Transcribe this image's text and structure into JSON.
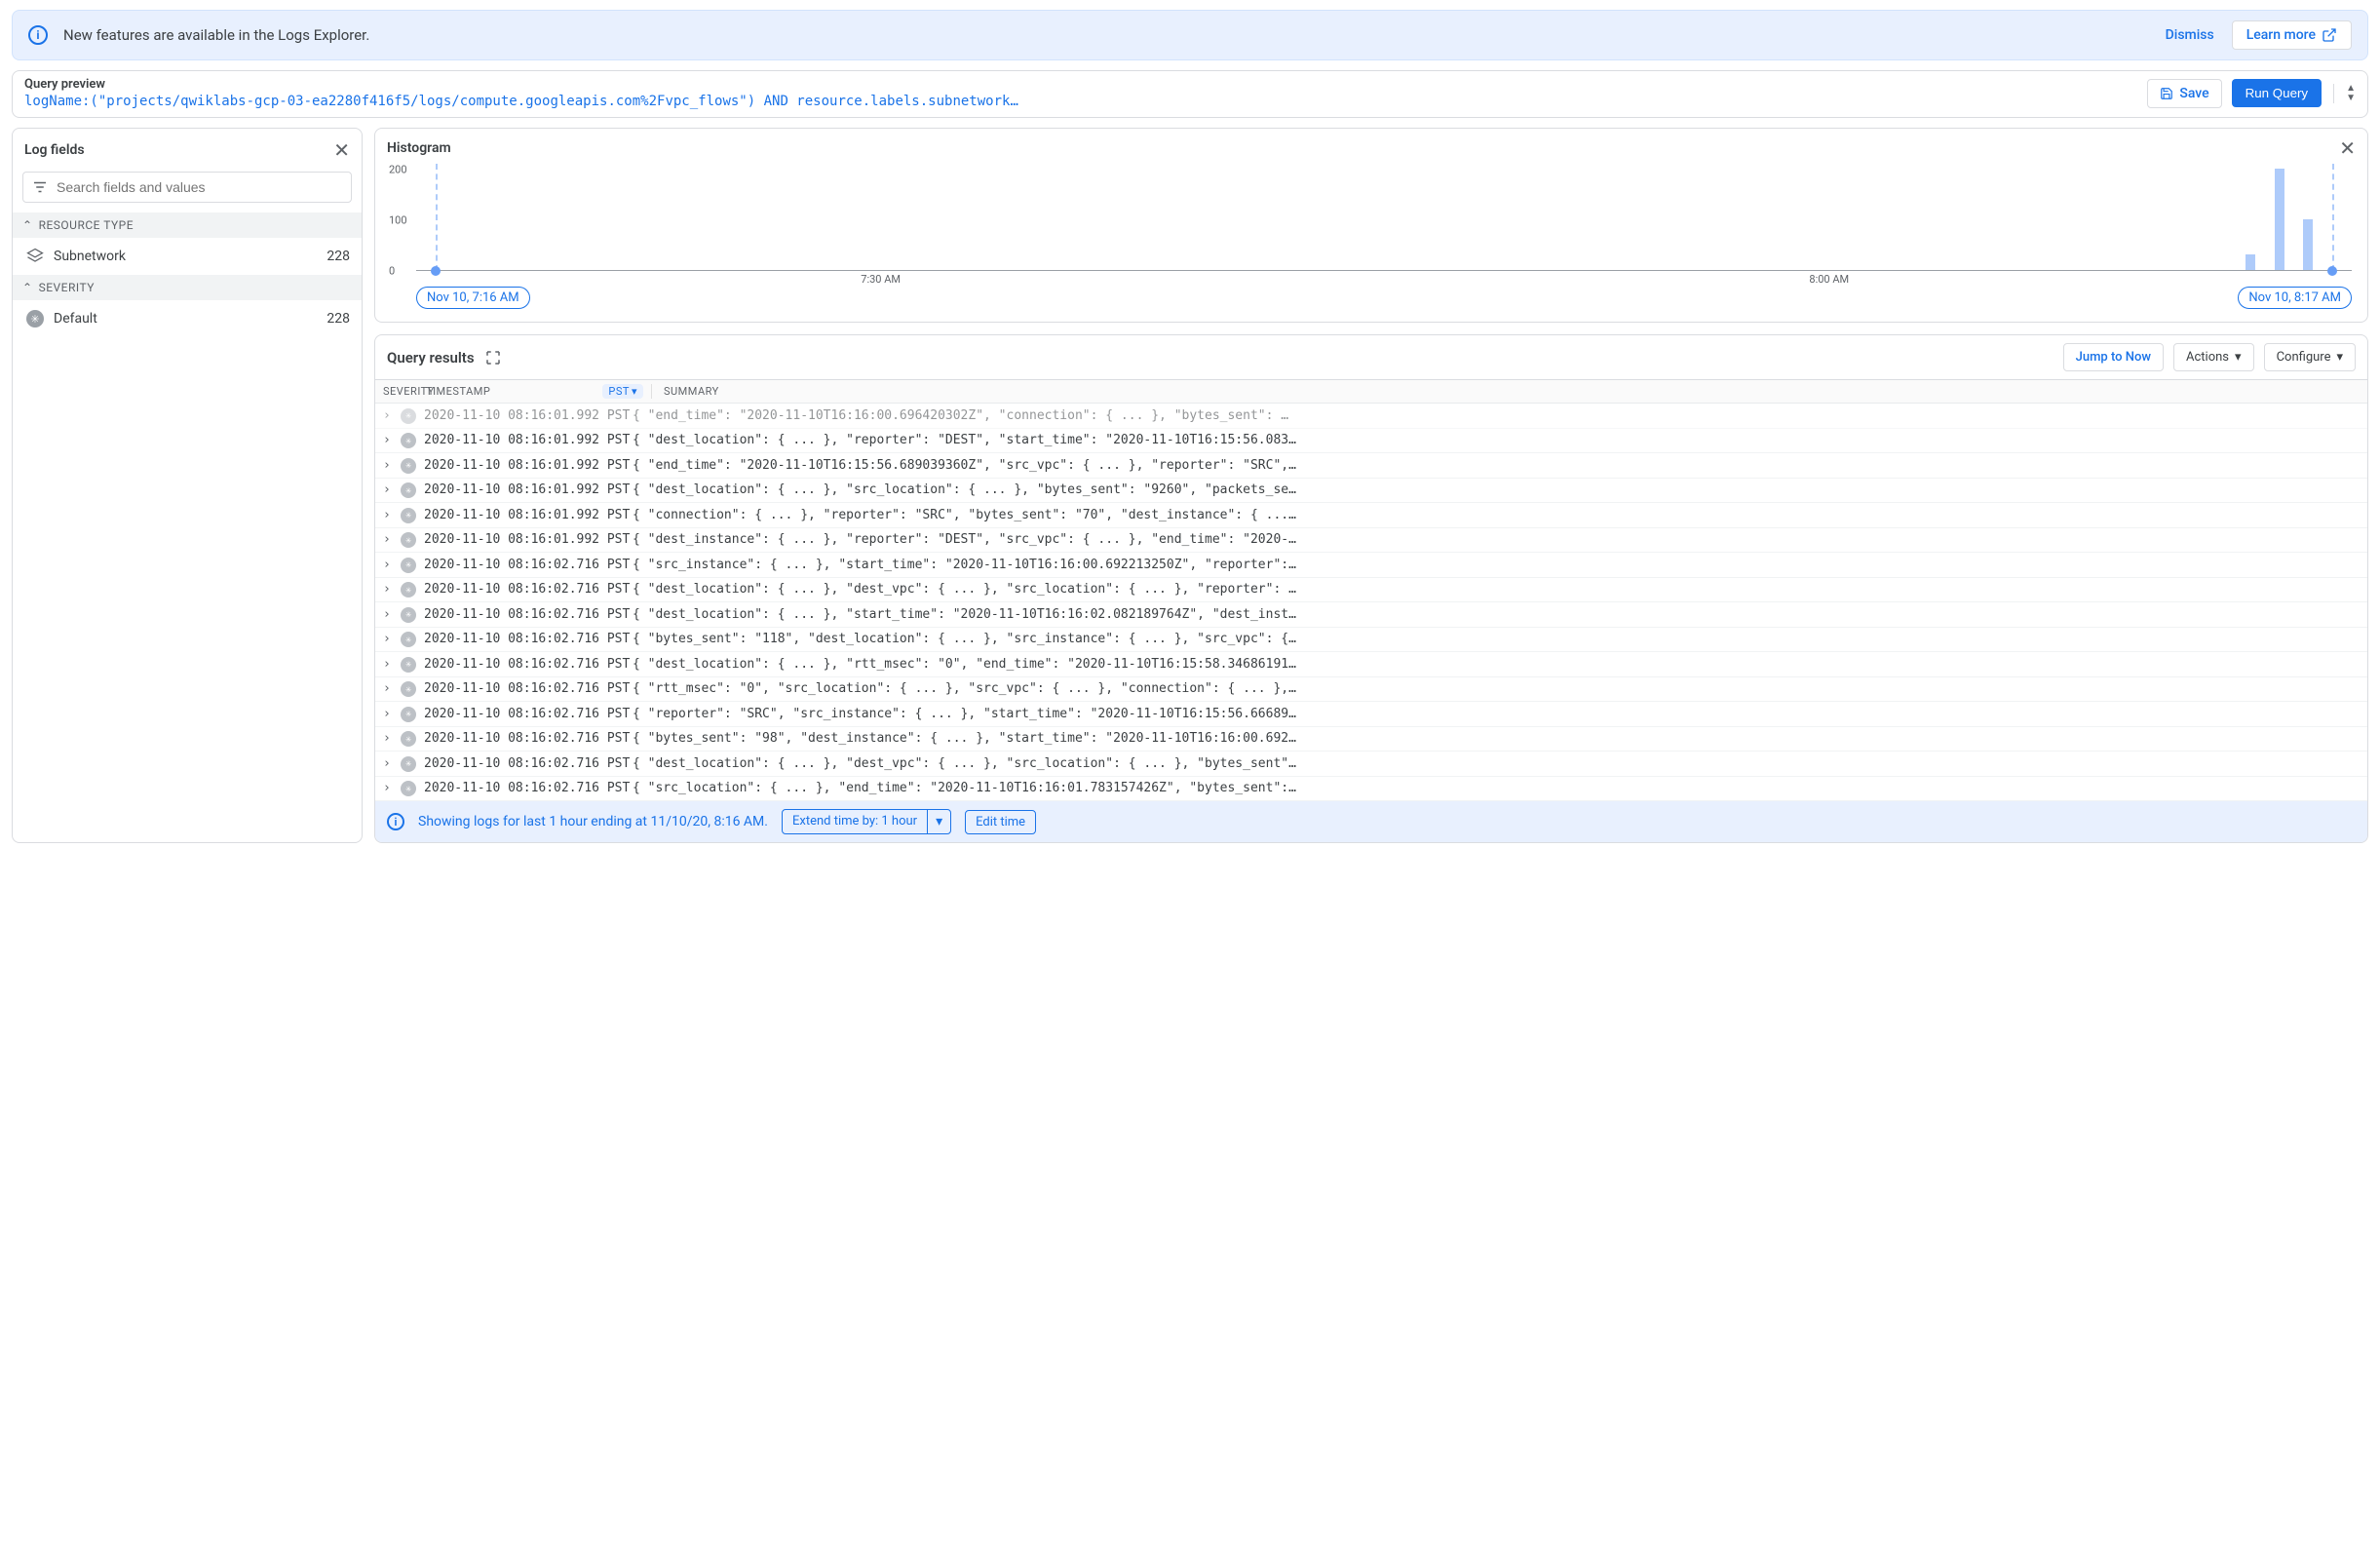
{
  "banner": {
    "message": "New features are available in the Logs Explorer.",
    "dismiss": "Dismiss",
    "learn_more": "Learn more"
  },
  "query_bar": {
    "label": "Query preview",
    "text": "logName:(\"projects/qwiklabs-gcp-03-ea2280f416f5/logs/compute.googleapis.com%2Fvpc_flows\") AND resource.labels.subnetwork…",
    "save": "Save",
    "run": "Run Query"
  },
  "log_fields": {
    "title": "Log fields",
    "search_placeholder": "Search fields and values",
    "sections": [
      {
        "name": "RESOURCE TYPE",
        "items": [
          {
            "label": "Subnetwork",
            "count": "228",
            "icon": "layers"
          }
        ]
      },
      {
        "name": "SEVERITY",
        "items": [
          {
            "label": "Default",
            "count": "228",
            "icon": "dot"
          }
        ]
      }
    ]
  },
  "histogram": {
    "title": "Histogram",
    "start_pill": "Nov 10, 7:16 AM",
    "end_pill": "Nov 10, 8:17 AM",
    "xticks": [
      "7:30 AM",
      "8:00 AM"
    ]
  },
  "chart_data": {
    "type": "bar",
    "title": "Histogram",
    "ylabel": "",
    "ylim": [
      0,
      200
    ],
    "yticks": [
      0,
      100,
      200
    ],
    "x_range": [
      "Nov 10, 7:16 AM",
      "Nov 10, 8:17 AM"
    ],
    "bars": [
      {
        "position_pct": 94.5,
        "value": 30
      },
      {
        "position_pct": 96.0,
        "value": 200
      },
      {
        "position_pct": 97.5,
        "value": 100
      }
    ]
  },
  "results": {
    "title": "Query results",
    "jump_now": "Jump to Now",
    "actions": "Actions",
    "configure": "Configure",
    "col_severity": "SEVERITY",
    "col_timestamp": "TIMESTAMP",
    "col_summary": "SUMMARY",
    "tz": "PST",
    "rows": [
      {
        "ts": "2020-11-10 08:16:01.992 PST",
        "summary": "\"end_time\": \"2020-11-10T16:16:00.696420302Z\", \"connection\": { ... }, \"bytes_sent\": …",
        "cut": true
      },
      {
        "ts": "2020-11-10 08:16:01.992 PST",
        "summary": "\"dest_location\": { ... }, \"reporter\": \"DEST\", \"start_time\": \"2020-11-10T16:15:56.083…"
      },
      {
        "ts": "2020-11-10 08:16:01.992 PST",
        "summary": "\"end_time\": \"2020-11-10T16:15:56.689039360Z\", \"src_vpc\": { ... }, \"reporter\": \"SRC\",…"
      },
      {
        "ts": "2020-11-10 08:16:01.992 PST",
        "summary": "\"dest_location\": { ... }, \"src_location\": { ... }, \"bytes_sent\": \"9260\", \"packets_se…"
      },
      {
        "ts": "2020-11-10 08:16:01.992 PST",
        "summary": "\"connection\": { ... }, \"reporter\": \"SRC\", \"bytes_sent\": \"70\", \"dest_instance\": { ...…"
      },
      {
        "ts": "2020-11-10 08:16:01.992 PST",
        "summary": "\"dest_instance\": { ... }, \"reporter\": \"DEST\", \"src_vpc\": { ... }, \"end_time\": \"2020-…"
      },
      {
        "ts": "2020-11-10 08:16:02.716 PST",
        "summary": "\"src_instance\": { ... }, \"start_time\": \"2020-11-10T16:16:00.692213250Z\", \"reporter\":…"
      },
      {
        "ts": "2020-11-10 08:16:02.716 PST",
        "summary": "\"dest_location\": { ... }, \"dest_vpc\": { ... }, \"src_location\": { ... }, \"reporter\": …"
      },
      {
        "ts": "2020-11-10 08:16:02.716 PST",
        "summary": "\"dest_location\": { ... }, \"start_time\": \"2020-11-10T16:16:02.082189764Z\", \"dest_inst…"
      },
      {
        "ts": "2020-11-10 08:16:02.716 PST",
        "summary": "\"bytes_sent\": \"118\", \"dest_location\": { ... }, \"src_instance\": { ... }, \"src_vpc\": {…"
      },
      {
        "ts": "2020-11-10 08:16:02.716 PST",
        "summary": "\"dest_location\": { ... }, \"rtt_msec\": \"0\", \"end_time\": \"2020-11-10T16:15:58.34686191…"
      },
      {
        "ts": "2020-11-10 08:16:02.716 PST",
        "summary": "\"rtt_msec\": \"0\", \"src_location\": { ... }, \"src_vpc\": { ... }, \"connection\": { ... },…"
      },
      {
        "ts": "2020-11-10 08:16:02.716 PST",
        "summary": "\"reporter\": \"SRC\", \"src_instance\": { ... }, \"start_time\": \"2020-11-10T16:15:56.66689…"
      },
      {
        "ts": "2020-11-10 08:16:02.716 PST",
        "summary": "\"bytes_sent\": \"98\", \"dest_instance\": { ... }, \"start_time\": \"2020-11-10T16:16:00.692…"
      },
      {
        "ts": "2020-11-10 08:16:02.716 PST",
        "summary": "\"dest_location\": { ... }, \"dest_vpc\": { ... }, \"src_location\": { ... }, \"bytes_sent\"…"
      },
      {
        "ts": "2020-11-10 08:16:02.716 PST",
        "summary": "\"src_location\": { ... }, \"end_time\": \"2020-11-10T16:16:01.783157426Z\", \"bytes_sent\":…"
      }
    ],
    "footer_msg": "Showing logs for last 1 hour ending at 11/10/20, 8:16 AM.",
    "extend_label": "Extend time by: 1 hour",
    "edit_time": "Edit time"
  }
}
